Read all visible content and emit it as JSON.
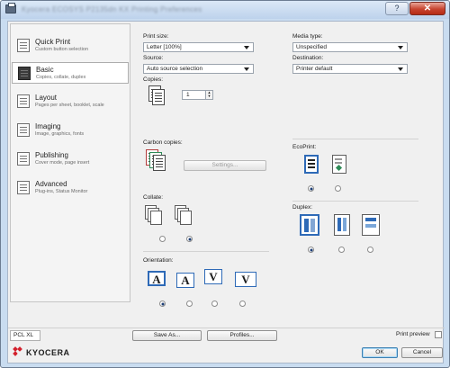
{
  "window": {
    "title": "Kyocera ECOSYS P2135dn KX Printing Preferences",
    "help_label": "?",
    "close_label": "✕"
  },
  "sidebar": {
    "items": [
      {
        "title": "Quick Print",
        "subtitle": "Custom button selection",
        "icon": "quick-print-icon"
      },
      {
        "title": "Basic",
        "subtitle": "Copies, collate, duplex",
        "icon": "basic-icon"
      },
      {
        "title": "Layout",
        "subtitle": "Pages per sheet, booklet, scale",
        "icon": "layout-icon"
      },
      {
        "title": "Imaging",
        "subtitle": "Image, graphics, fonts",
        "icon": "imaging-icon"
      },
      {
        "title": "Publishing",
        "subtitle": "Cover mode, page insert",
        "icon": "publishing-icon"
      },
      {
        "title": "Advanced",
        "subtitle": "Plug-ins, Status Monitor",
        "icon": "advanced-icon"
      }
    ]
  },
  "main": {
    "print_size": {
      "label": "Print size:",
      "value": "Letter  [100%]"
    },
    "source": {
      "label": "Source:",
      "value": "Auto source selection"
    },
    "copies": {
      "label": "Copies:",
      "value": "1"
    },
    "carbon_copies": {
      "label": "Carbon copies:",
      "settings_label": "Settings..."
    },
    "collate": {
      "label": "Collate:"
    },
    "orientation": {
      "label": "Orientation:",
      "glyph": "A",
      "glyph_v": "V",
      "selected_index": 0
    },
    "media_type": {
      "label": "Media type:",
      "value": "Unspecified"
    },
    "destination": {
      "label": "Destination:",
      "value": "Printer default"
    },
    "ecoprint": {
      "label": "EcoPrint:",
      "selected_index": 0
    },
    "duplex": {
      "label": "Duplex:",
      "selected_index": 0
    }
  },
  "footer": {
    "pdl": "PCL XL",
    "save_as_label": "Save As...",
    "profiles_label": "Profiles...",
    "print_preview_label": "Print preview",
    "ok_label": "OK",
    "cancel_label": "Cancel",
    "brand": "KYOCERA"
  },
  "colors": {
    "brand_red": "#d3212d",
    "selection_blue": "#2e6ab7"
  }
}
